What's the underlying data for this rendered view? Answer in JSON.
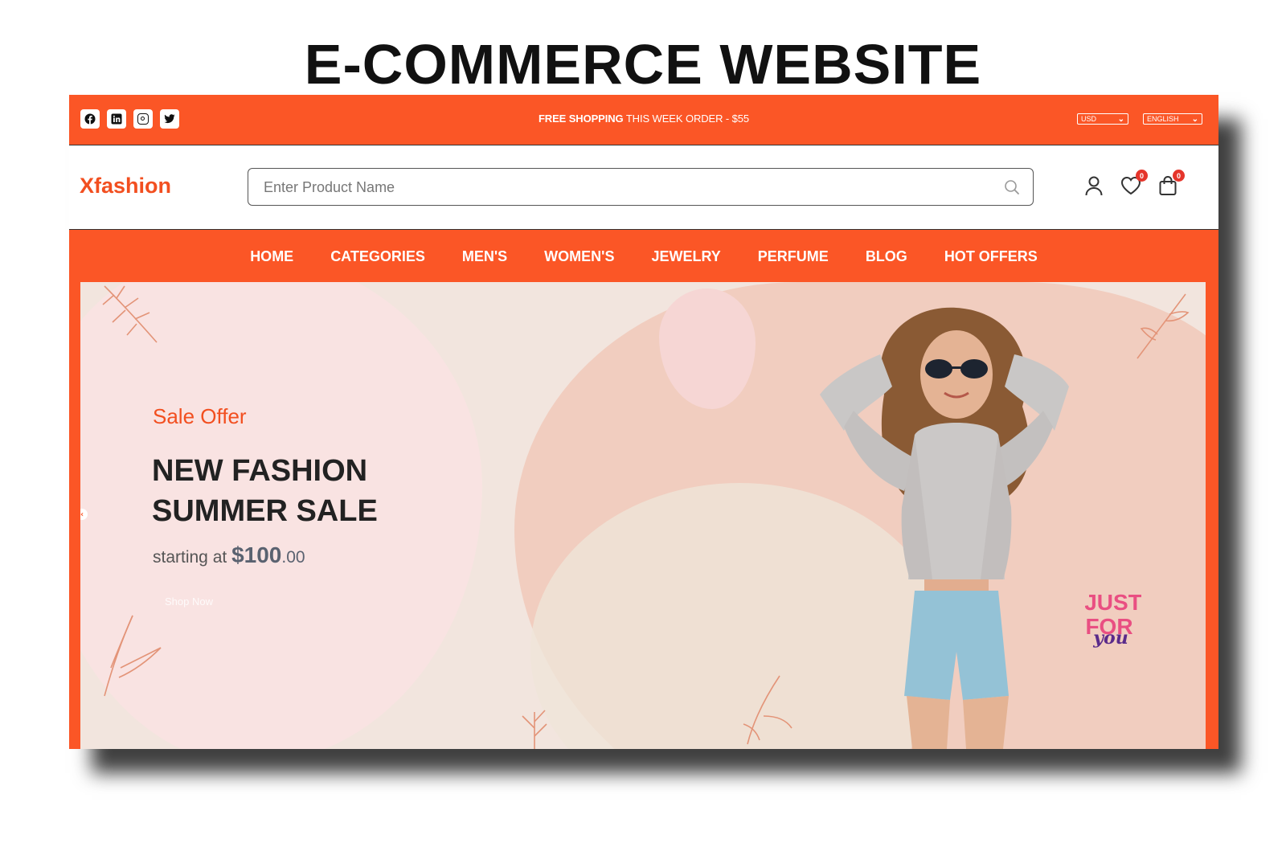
{
  "page_title": "E-COMMERCE WEBSITE",
  "topbar": {
    "socials": [
      {
        "name": "facebook-icon",
        "glyph": "f"
      },
      {
        "name": "linkedin-icon",
        "glyph": "in"
      },
      {
        "name": "instagram-icon",
        "glyph": ""
      },
      {
        "name": "twitter-icon",
        "glyph": "t"
      }
    ],
    "promo_bold": "FREE SHOPPING",
    "promo_rest": " THIS WEEK ORDER - $55",
    "currency": "USD",
    "language": "ENGLISH"
  },
  "header": {
    "logo": "Xfashion",
    "search_placeholder": "Enter Product Name",
    "wishlist_count": "0",
    "cart_count": "0"
  },
  "nav": {
    "items": [
      "HOME",
      "CATEGORIES",
      "MEN'S",
      "WOMEN'S",
      "JEWELRY",
      "PERFUME",
      "BLOG",
      "HOT OFFERS"
    ]
  },
  "hero": {
    "eyebrow": "Sale Offer",
    "headline_line1": "NEW FASHION",
    "headline_line2": "SUMMER SALE",
    "price_prefix": "starting at ",
    "price_big": "$100",
    "price_small": ".00",
    "cta": "Shop Now",
    "sticker_line1": "JUST",
    "sticker_line2": "FOR",
    "sticker_line3": "you"
  },
  "colors": {
    "accent": "#fb5626",
    "logo": "#f24f20",
    "badge": "#e5352b"
  }
}
